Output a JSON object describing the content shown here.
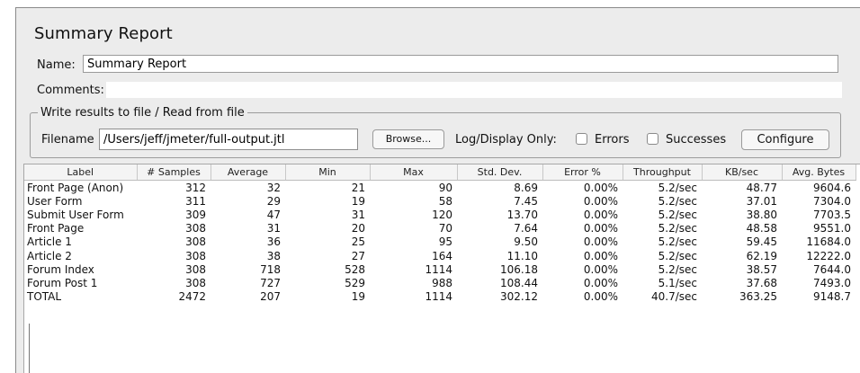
{
  "title": "Summary Report",
  "name": {
    "label": "Name:",
    "value": "Summary Report"
  },
  "comments": {
    "label": "Comments:",
    "value": ""
  },
  "write_results": {
    "legend": "Write results to file / Read from file",
    "filename_label": "Filename",
    "filename_value": "/Users/jeff/jmeter/full-output.jtl",
    "browse_label": "Browse...",
    "log_display_label": "Log/Display Only:",
    "errors_label": "Errors",
    "errors_checked": false,
    "successes_label": "Successes",
    "successes_checked": false,
    "configure_label": "Configure"
  },
  "table": {
    "columns": [
      "Label",
      "# Samples",
      "Average",
      "Min",
      "Max",
      "Std. Dev.",
      "Error %",
      "Throughput",
      "KB/sec",
      "Avg. Bytes"
    ],
    "rows": [
      [
        "Front Page (Anon)",
        "312",
        "32",
        "21",
        "90",
        "8.69",
        "0.00%",
        "5.2/sec",
        "48.77",
        "9604.6"
      ],
      [
        "User Form",
        "311",
        "29",
        "19",
        "58",
        "7.45",
        "0.00%",
        "5.2/sec",
        "37.01",
        "7304.0"
      ],
      [
        "Submit User Form",
        "309",
        "47",
        "31",
        "120",
        "13.70",
        "0.00%",
        "5.2/sec",
        "38.80",
        "7703.5"
      ],
      [
        "Front Page",
        "308",
        "31",
        "20",
        "70",
        "7.64",
        "0.00%",
        "5.2/sec",
        "48.58",
        "9551.0"
      ],
      [
        "Article 1",
        "308",
        "36",
        "25",
        "95",
        "9.50",
        "0.00%",
        "5.2/sec",
        "59.45",
        "11684.0"
      ],
      [
        "Article 2",
        "308",
        "38",
        "27",
        "164",
        "11.10",
        "0.00%",
        "5.2/sec",
        "62.19",
        "12222.0"
      ],
      [
        "Forum Index",
        "308",
        "718",
        "528",
        "1114",
        "106.18",
        "0.00%",
        "5.2/sec",
        "38.57",
        "7644.0"
      ],
      [
        "Forum Post 1",
        "308",
        "727",
        "529",
        "988",
        "108.44",
        "0.00%",
        "5.1/sec",
        "37.68",
        "7493.0"
      ],
      [
        "TOTAL",
        "2472",
        "207",
        "19",
        "1114",
        "302.12",
        "0.00%",
        "40.7/sec",
        "363.25",
        "9148.7"
      ]
    ]
  }
}
